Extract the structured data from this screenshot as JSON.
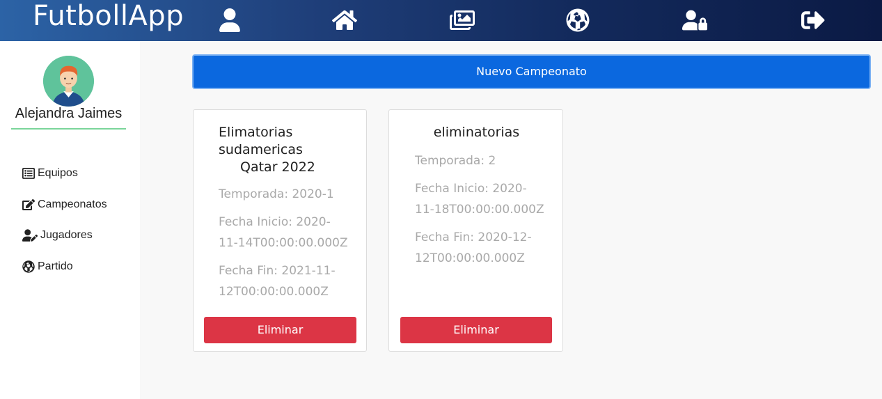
{
  "app": {
    "brand": "FutbollApp"
  },
  "topnav": [
    {
      "icon": "user-icon"
    },
    {
      "icon": "home-icon"
    },
    {
      "icon": "images-icon"
    },
    {
      "icon": "soccer-ball-icon"
    },
    {
      "icon": "user-lock-icon"
    },
    {
      "icon": "sign-out-icon"
    }
  ],
  "sidebar": {
    "user_name": "Alejandra Jaimes",
    "items": [
      {
        "label": "Equipos",
        "icon": "calendar-list-icon"
      },
      {
        "label": "Campeonatos",
        "icon": "edit-icon"
      },
      {
        "label": "Jugadores",
        "icon": "user-edit-icon"
      },
      {
        "label": "Partido",
        "icon": "soccer-ball-icon"
      }
    ]
  },
  "main": {
    "new_button": "Nuevo Campeonato",
    "cards": [
      {
        "title_lines": [
          "Elimatorias",
          "sudamericas",
          "Qatar 2022"
        ],
        "season": "Temporada: 2020-1",
        "start_lines": [
          "Fecha Inicio: 2020-",
          "11-14T00:00:00.000Z"
        ],
        "end_lines": [
          "Fecha Fin: 2021-11-",
          "12T00:00:00.000Z"
        ],
        "delete_label": "Eliminar"
      },
      {
        "title_lines": [
          "eliminatorias"
        ],
        "season": "Temporada: 2",
        "start_lines": [
          "Fecha Inicio: 2020-",
          "11-18T00:00:00.000Z"
        ],
        "end_lines": [
          "Fecha Fin: 2020-12-",
          "12T00:00:00.000Z"
        ],
        "delete_label": "Eliminar"
      }
    ]
  },
  "colors": {
    "primary": "#0b68df",
    "danger": "#dc3545",
    "accent_green": "#7ad59a"
  }
}
